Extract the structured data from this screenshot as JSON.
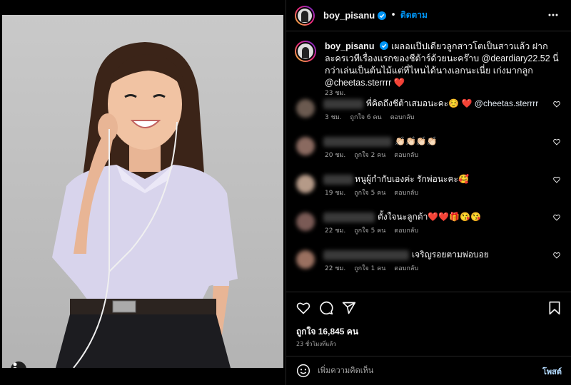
{
  "post": {
    "username": "boy_pisanu",
    "follow_label": "ติดตาม",
    "separator": "•",
    "caption": "เผลอแป๊ปเดียวลูกสาวโตเป็นสาวแล้ว ฝากละครเวทีเรื่องแรกของชีต้าร์ด้วยนะคร๊าบ @deardiary22.52 นี่กว่าเล่นเป็นต้นไม้แต่ที่ไหนได้นางเอกนะเนี่ย เก่งมากลูก @cheetas.sterrrr ❤️",
    "caption_time": "23 ชม."
  },
  "comments": [
    {
      "text": "พี่คิดถึงชีต้าเสมอนะคะ☺️ ❤️",
      "mention": " @cheetas.sterrrr",
      "time": "3 ชม.",
      "likes": "ถูกใจ 6 คน",
      "reply": "ตอบกลับ"
    },
    {
      "text": "👏🏻👏🏻👏🏻👏🏻",
      "mention": "",
      "time": "20 ชม.",
      "likes": "ถูกใจ 2 คน",
      "reply": "ตอบกลับ"
    },
    {
      "text": "หนูผู้กำกับเองค่ะ รักพ่อนะคะ🥰",
      "mention": "",
      "time": "19 ชม.",
      "likes": "ถูกใจ 5 คน",
      "reply": "ตอบกลับ"
    },
    {
      "text": "ตั้งใจนะลูกต้า❤️❤️🎁😘😘",
      "mention": "",
      "time": "22 ชม.",
      "likes": "ถูกใจ 5 คน",
      "reply": "ตอบกลับ"
    },
    {
      "text": "เจริญรอยตามพ่อบอย",
      "mention": "",
      "time": "22 ชม.",
      "likes": "ถูกใจ 1 คน",
      "reply": "ตอบกลับ"
    }
  ],
  "actions": {
    "like_icon": "heart-icon",
    "comment_icon": "comment-icon",
    "share_icon": "share-icon",
    "save_icon": "bookmark-icon",
    "likes_count": "ถูกใจ 16,845 คน",
    "time_ago": "23 ชั่วโมงที่แล้ว"
  },
  "add_comment": {
    "placeholder": "เพิ่มความคิดเห็น",
    "post_label": "โพสต์"
  },
  "colors": {
    "accent": "#0095f6",
    "background": "#000000",
    "muted_text": "#a8a8a8",
    "divider": "#262626"
  }
}
